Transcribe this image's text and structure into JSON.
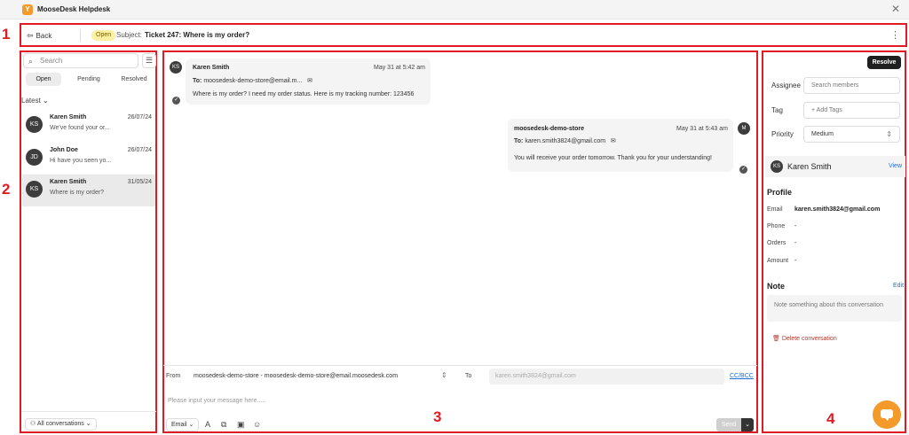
{
  "window": {
    "app_title": "MooseDesk Helpdesk",
    "close_icon": "close-icon"
  },
  "annotations": {
    "n1": "1",
    "n2": "2",
    "n3": "3",
    "n4": "4",
    "color": "#e01b24"
  },
  "header": {
    "back_label": "Back",
    "status_badge": "Open",
    "subject_label": "Subject:",
    "subject": "Ticket 247: Where is my order?"
  },
  "left": {
    "search_placeholder": "Search",
    "tabs": [
      "Open",
      "Pending",
      "Resolved"
    ],
    "sort_label": "Latest",
    "conversations": [
      {
        "initials": "KS",
        "name": "Karen Smith",
        "date": "26/07/24",
        "preview": "We've found your or..."
      },
      {
        "initials": "JD",
        "name": "John Doe",
        "date": "26/07/24",
        "preview": "Hi have you seen yo..."
      },
      {
        "initials": "KS",
        "name": "Karen Smith",
        "date": "31/05/24",
        "preview": "Where is my order?"
      }
    ],
    "all_conversations_label": "All conversations"
  },
  "messages": [
    {
      "initials": "KS",
      "name": "Karen Smith",
      "date": "May 31 at 5:42 am",
      "to_label": "To:",
      "to": "moosedesk-demo-store@email.m...",
      "body": "Where is my order? I need my order status. Here is my tracking number: 123456"
    },
    {
      "initials": "M",
      "name": "moosedesk-demo-store",
      "date": "May 31 at 5:43 am",
      "to_label": "To:",
      "to": "karen.smith3824@gmail.com",
      "body": "You will receive your order tomorrow. Thank you for your understanding!"
    }
  ],
  "composer": {
    "from_label": "From",
    "from_value": "moosedesk-demo-store - moosedesk-demo-store@email.moosedesk.com",
    "to_label": "To",
    "to_value": "karen.smith3824@gmail.com",
    "ccbcc": "CC/BCC",
    "message_placeholder": "Please input your message here.....",
    "channel": "Email",
    "send_label": "Send"
  },
  "right": {
    "resolve_label": "Resolve",
    "assignee_label": "Assignee",
    "assignee_placeholder": "Search members",
    "tag_label": "Tag",
    "tag_placeholder": "+ Add Tags",
    "priority_label": "Priority",
    "priority_value": "Medium",
    "customer_initials": "KS",
    "customer_name": "Karen Smith",
    "view_label": "View",
    "profile_title": "Profile",
    "profile": [
      {
        "label": "Email",
        "value": "karen.smith3824@gmail.com"
      },
      {
        "label": "Phone",
        "value": "-"
      },
      {
        "label": "Orders",
        "value": "-"
      },
      {
        "label": "Amount",
        "value": "-"
      }
    ],
    "note_title": "Note",
    "edit_label": "Edit",
    "note_placeholder": "Note something about this conversation",
    "delete_label": "Delete conversation"
  }
}
